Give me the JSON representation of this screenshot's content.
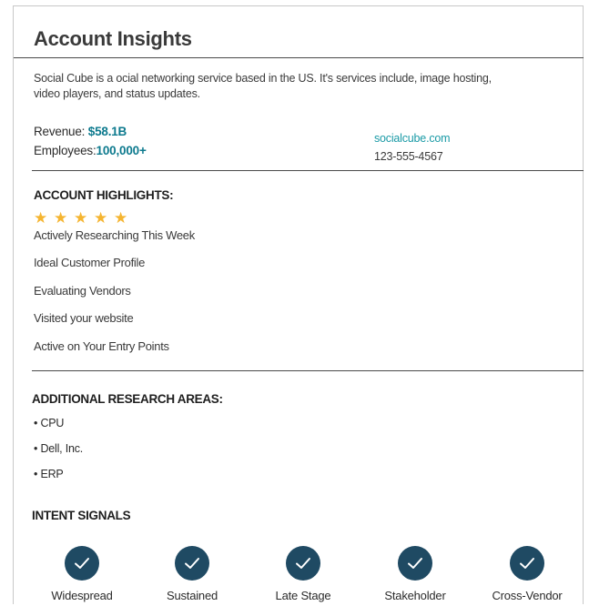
{
  "title": "Account Insights",
  "description": "Social Cube is a ocial networking service based in the US. It's services include, image hosting, video players, and status updates.",
  "revenue": {
    "label": "Revenue:",
    "value": "$58.1B"
  },
  "employees": {
    "label": "Employees:",
    "value": "100,000+"
  },
  "website": "socialcube.com",
  "phone": "123-555-4567",
  "highlights": {
    "heading": "ACCOUNT HIGHLIGHTS:",
    "rating_stars": 5,
    "star_color": "#f5b531",
    "items": [
      "Actively Researching This Week",
      "Ideal Customer Profile",
      "Evaluating Vendors",
      "Visited your website",
      "Active on Your Entry Points"
    ]
  },
  "research": {
    "heading": "ADDITIONAL RESEARCH AREAS:",
    "items": [
      "CPU",
      "Dell, Inc.",
      "ERP"
    ]
  },
  "intent": {
    "heading": "INTENT SIGNALS",
    "icon": "check-circle-icon",
    "circle_color": "#1f4a63",
    "items": [
      "Widespread",
      "Sustained",
      "Late Stage",
      "Stakeholder",
      "Cross-Vendor"
    ]
  },
  "accent_color": "#0d7a8e"
}
